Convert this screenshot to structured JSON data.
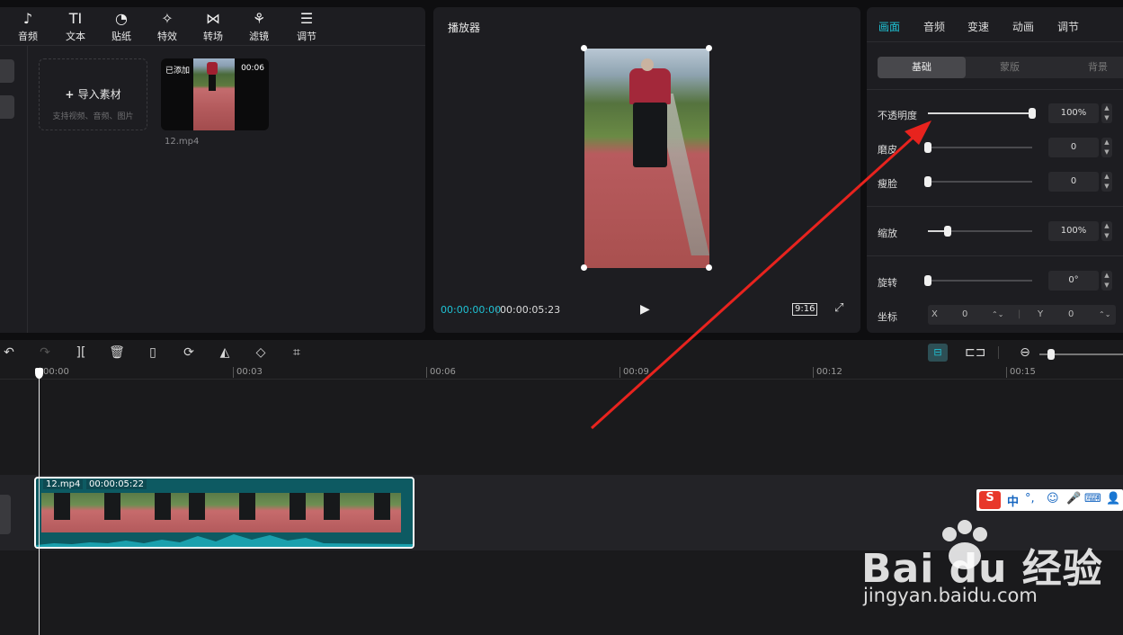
{
  "toolbar": {
    "items": [
      {
        "label": "音频",
        "icon": "music-note-icon",
        "glyph": "♪"
      },
      {
        "label": "文本",
        "icon": "text-icon",
        "glyph": "TI"
      },
      {
        "label": "贴纸",
        "icon": "sticker-icon",
        "glyph": "◔"
      },
      {
        "label": "特效",
        "icon": "effects-star-icon",
        "glyph": "✧"
      },
      {
        "label": "转场",
        "icon": "transition-icon",
        "glyph": "⋈"
      },
      {
        "label": "滤镜",
        "icon": "filter-icon",
        "glyph": "⚘"
      },
      {
        "label": "调节",
        "icon": "adjust-sliders-icon",
        "glyph": "☰"
      }
    ]
  },
  "library": {
    "import_label": "导入素材",
    "import_hint": "支持视频、音频、图片",
    "media": {
      "badge": "已添加",
      "duration": "00:06",
      "filename": "12.mp4"
    }
  },
  "player": {
    "title": "播放器",
    "current_time": "00:00:00:00",
    "total_time": "00:00:05:23",
    "ratio": "9:16"
  },
  "inspector": {
    "tabs": [
      "画面",
      "音频",
      "变速",
      "动画",
      "调节"
    ],
    "active_tab": "画面",
    "subtabs": [
      "基础",
      "蒙版",
      "背景"
    ],
    "active_subtab": "基础",
    "opacity": {
      "label": "不透明度",
      "value": "100%",
      "level": 1.0
    },
    "smooth": {
      "label": "磨皮",
      "value": "0",
      "level": 0.0
    },
    "slim": {
      "label": "瘦脸",
      "value": "0",
      "level": 0.0
    },
    "scale": {
      "label": "缩放",
      "value": "100%",
      "level": 0.2
    },
    "rotate": {
      "label": "旋转",
      "value": "0°",
      "level": 0.0
    },
    "position": {
      "label": "坐标",
      "x_label": "X",
      "x": "0",
      "y_label": "Y",
      "y": "0"
    }
  },
  "timeline": {
    "ticks": [
      "00:00",
      "00:03",
      "00:06",
      "00:09",
      "00:12",
      "00:15"
    ],
    "clip": {
      "name": "12.mp4",
      "duration": "00:00:05:22"
    }
  },
  "ime": {
    "lang": "中",
    "punct": "°,"
  },
  "watermark": {
    "brand": "Bai du 经验",
    "url": "jingyan.baidu.com"
  },
  "colors": {
    "accent": "#1fc2d4",
    "arrow": "#e8231e",
    "clip": "#0d5a62"
  }
}
